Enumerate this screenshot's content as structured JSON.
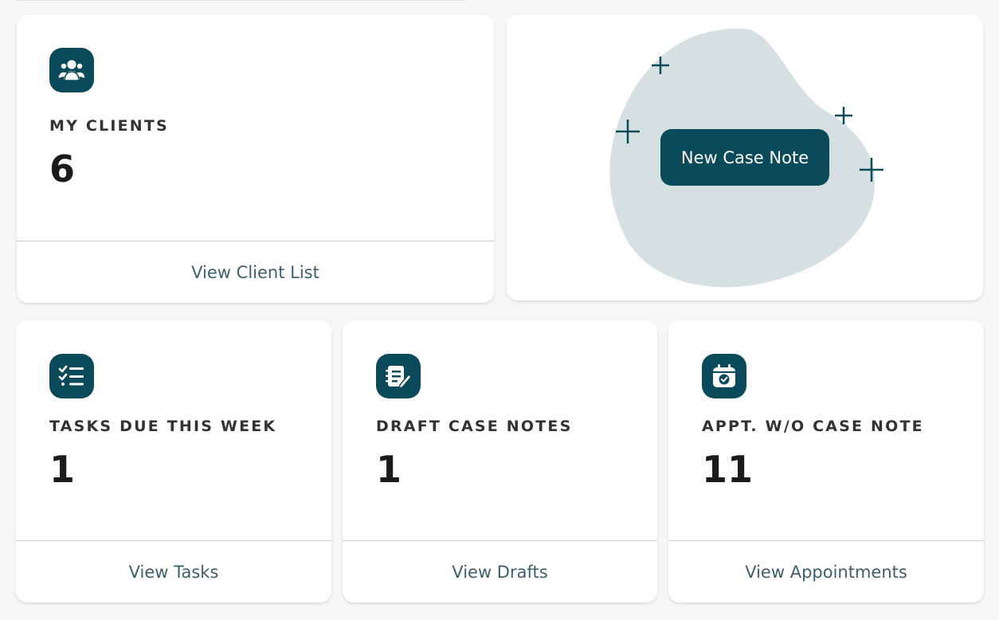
{
  "theme": {
    "accent": "#0b4a5a",
    "blob": "#d6e0e2",
    "link": "#3d5f6b",
    "background": "#f6f6f6"
  },
  "my_clients": {
    "icon": "users-icon",
    "label": "MY CLIENTS",
    "value": "6",
    "link": "View Client List"
  },
  "cta": {
    "button": "New Case Note",
    "decoration": "sparkle-icon"
  },
  "tasks": {
    "icon": "checklist-icon",
    "label": "TASKS DUE THIS WEEK",
    "value": "1",
    "link": "View Tasks"
  },
  "drafts": {
    "icon": "notebook-edit-icon",
    "label": "DRAFT CASE NOTES",
    "value": "1",
    "link": "View Drafts"
  },
  "appointments": {
    "icon": "calendar-check-icon",
    "label": "APPT. W/O CASE NOTE",
    "value": "11",
    "link": "View Appointments"
  }
}
